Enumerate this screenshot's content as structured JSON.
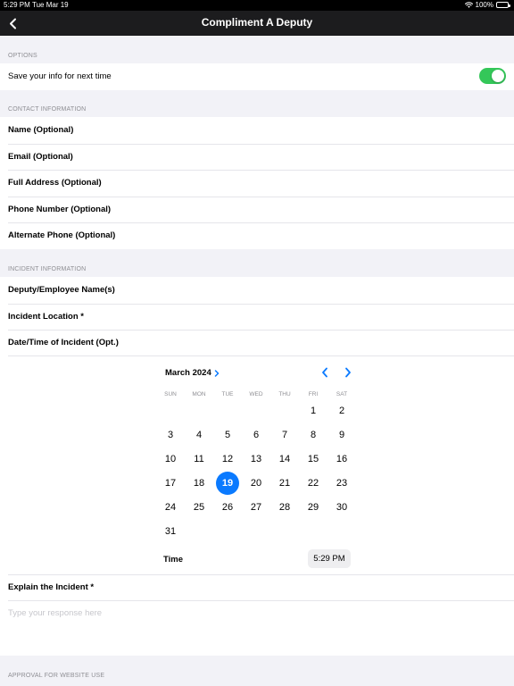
{
  "status_bar": {
    "time": "5:29 PM",
    "date": "Tue Mar 19",
    "battery": "100%"
  },
  "nav": {
    "title": "Compliment A Deputy"
  },
  "options": {
    "header": "OPTIONS",
    "save_info_label": "Save your info for next time",
    "save_info_enabled": true
  },
  "contact": {
    "header": "CONTACT INFORMATION",
    "fields": [
      {
        "label": "Name (Optional)"
      },
      {
        "label": "Email (Optional)"
      },
      {
        "label": "Full Address (Optional)"
      },
      {
        "label": "Phone Number (Optional)"
      },
      {
        "label": "Alternate Phone (Optional)"
      }
    ]
  },
  "incident": {
    "header": "INCIDENT INFORMATION",
    "fields": [
      {
        "label": "Deputy/Employee Name(s)"
      },
      {
        "label": "Incident Location *"
      },
      {
        "label": "Date/Time of Incident (Opt.)"
      }
    ]
  },
  "calendar": {
    "month_label": "March 2024",
    "weekdays": [
      "SUN",
      "MON",
      "TUE",
      "WED",
      "THU",
      "FRI",
      "SAT"
    ],
    "first_weekday_index": 5,
    "days_in_month": 31,
    "selected_day": 19,
    "time_label": "Time",
    "time_value": "5:29 PM"
  },
  "explain": {
    "label": "Explain the Incident *",
    "placeholder": "Type your response here",
    "value": ""
  },
  "approval": {
    "header": "APPROVAL FOR WEBSITE USE"
  },
  "colors": {
    "accent": "#0a7aff",
    "toggle_on": "#34c759",
    "nav_bg": "#1c1c1e"
  }
}
